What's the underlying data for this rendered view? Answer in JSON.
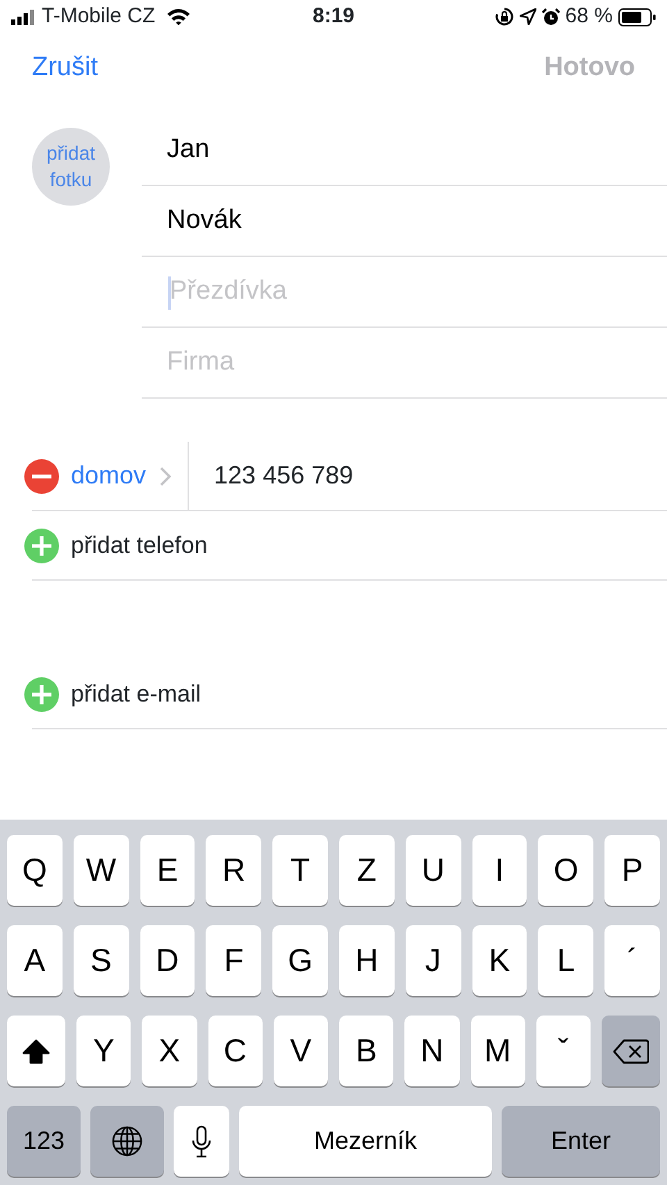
{
  "status_bar": {
    "carrier": "T-Mobile CZ",
    "time": "8:19",
    "battery": "68 %"
  },
  "nav": {
    "cancel": "Zrušit",
    "done": {
      "label": "Hotovo",
      "disabled": true
    }
  },
  "photo": {
    "label": "přidat fotku"
  },
  "name_fields": [
    {
      "value": "Jan",
      "focused": false
    },
    {
      "value": "Novák",
      "focused": false
    },
    {
      "placeholder": "Přezdívka",
      "focused": true
    },
    {
      "placeholder": "Firma",
      "focused": false
    }
  ],
  "phones": [
    {
      "label": "domov",
      "number": "123 456 789"
    }
  ],
  "add_phone": "přidat telefon",
  "add_email": "přidat e-mail",
  "keyboard": {
    "rows": [
      [
        {
          "kind": "char",
          "label": "Q"
        },
        {
          "kind": "char",
          "label": "W"
        },
        {
          "kind": "char",
          "label": "E"
        },
        {
          "kind": "char",
          "label": "R"
        },
        {
          "kind": "char",
          "label": "T"
        },
        {
          "kind": "char",
          "label": "Z"
        },
        {
          "kind": "char",
          "label": "U"
        },
        {
          "kind": "char",
          "label": "I"
        },
        {
          "kind": "char",
          "label": "O"
        },
        {
          "kind": "char",
          "label": "P"
        }
      ],
      [
        {
          "kind": "char",
          "label": "A"
        },
        {
          "kind": "char",
          "label": "S"
        },
        {
          "kind": "char",
          "label": "D"
        },
        {
          "kind": "char",
          "label": "F"
        },
        {
          "kind": "char",
          "label": "G"
        },
        {
          "kind": "char",
          "label": "H"
        },
        {
          "kind": "char",
          "label": "J"
        },
        {
          "kind": "char",
          "label": "K"
        },
        {
          "kind": "char",
          "label": "L"
        },
        {
          "kind": "char",
          "label": "´"
        }
      ],
      [
        {
          "kind": "shift",
          "on": true
        },
        {
          "kind": "char",
          "label": "Y"
        },
        {
          "kind": "char",
          "label": "X"
        },
        {
          "kind": "char",
          "label": "C"
        },
        {
          "kind": "char",
          "label": "V"
        },
        {
          "kind": "char",
          "label": "B"
        },
        {
          "kind": "char",
          "label": "N"
        },
        {
          "kind": "char",
          "label": "M"
        },
        {
          "kind": "char",
          "label": "ˇ"
        },
        {
          "kind": "backspace"
        }
      ]
    ],
    "bottom_bar": [
      {
        "kind": "mode",
        "label": "123"
      },
      {
        "kind": "globe"
      },
      {
        "kind": "mic"
      },
      {
        "kind": "space",
        "label": "Mezerník"
      },
      {
        "kind": "enter",
        "label": "Enter"
      }
    ]
  }
}
